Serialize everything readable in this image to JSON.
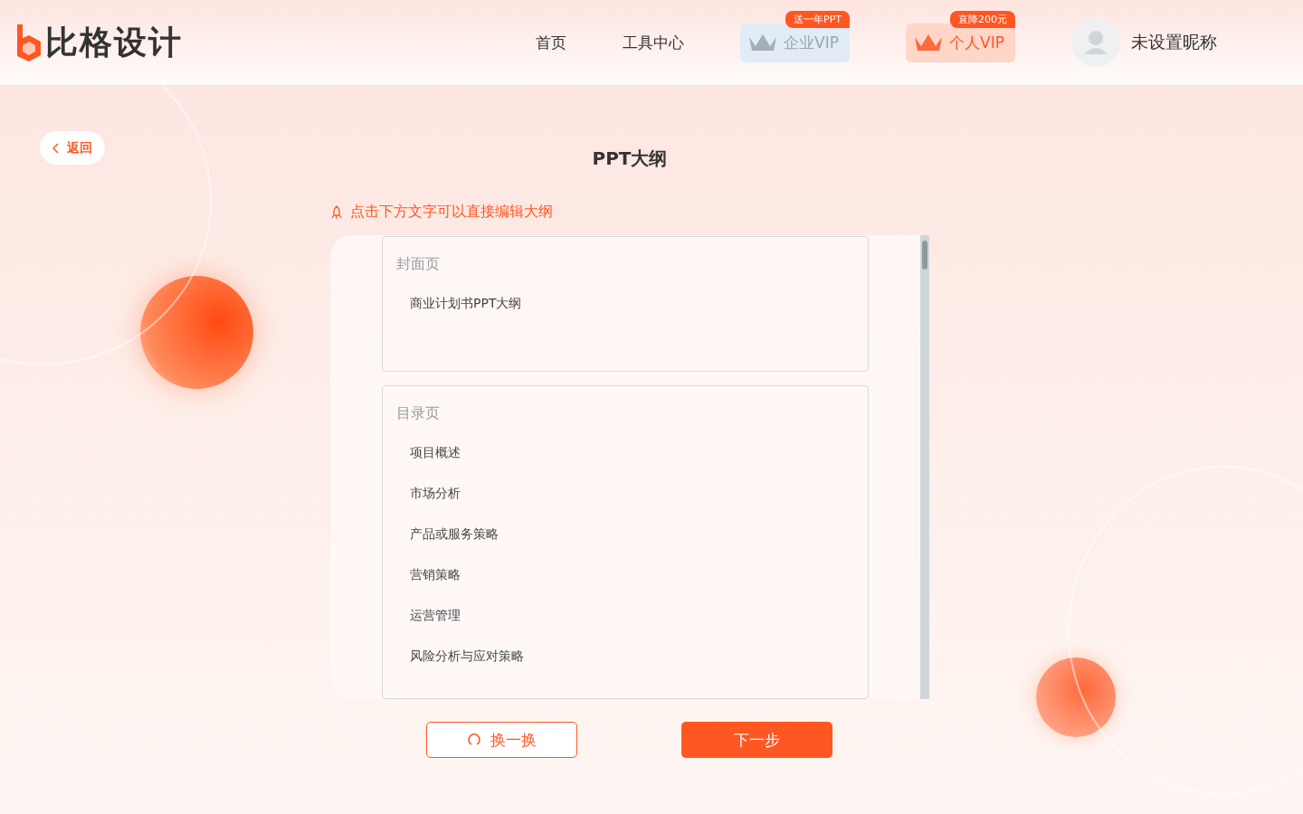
{
  "header": {
    "logo_text": "比格设计",
    "nav": [
      {
        "label": "首页"
      },
      {
        "label": "工具中心"
      }
    ],
    "vip": [
      {
        "kind": "enterprise",
        "label": "企业VIP",
        "badge": "送一年PPT"
      },
      {
        "kind": "personal",
        "label": "个人VIP",
        "badge": "直降200元"
      }
    ],
    "user": {
      "name": "未设置昵称"
    }
  },
  "back": "返回",
  "title": "PPT大纲",
  "hint": "点击下方文字可以直接编辑大纲",
  "sections": [
    {
      "title": "封面页",
      "items": [
        "商业计划书PPT大纲"
      ]
    },
    {
      "title": "目录页",
      "items": [
        "项目概述",
        "市场分析",
        "产品或服务策略",
        "营销策略",
        "运营管理",
        "风险分析与应对策略"
      ]
    }
  ],
  "buttons": {
    "refresh": "换一换",
    "next": "下一步"
  }
}
